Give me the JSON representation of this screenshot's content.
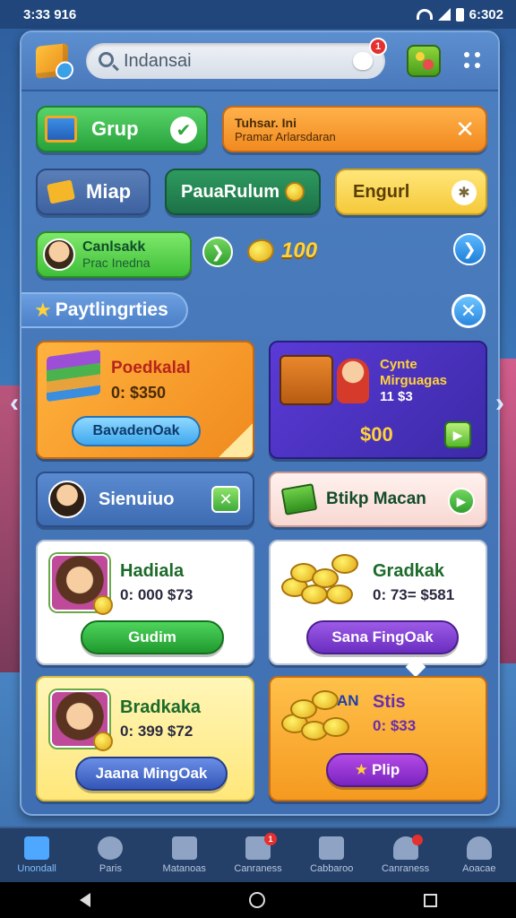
{
  "status_bar": {
    "time": "3:33 916",
    "battery_text": "6:302"
  },
  "header": {
    "search_value": "Indansai",
    "search_badge": "1"
  },
  "row1": {
    "grup_label": "Grup",
    "notice_line1": "Tuhsar. Ini",
    "notice_line2": "Pramar Arlarsdaran"
  },
  "row2": {
    "map_label": "Miap",
    "premium_label": "PauaRulum",
    "english_label": "Engurl"
  },
  "row3": {
    "user_name": "Canlsakk",
    "user_sub": "Prac Inedna",
    "coin_amount": "100"
  },
  "section": {
    "title": "Paytlingrties"
  },
  "promos": [
    {
      "title": "Poedkalal",
      "value": "0: $350",
      "button": "BavadenOak"
    },
    {
      "title": "Cynte Mirguagas",
      "value": "11 $3",
      "price": "$00"
    }
  ],
  "row_mid": {
    "rank_label": "Sienuiuo",
    "bank_label": "Btikp Macan"
  },
  "offers": [
    {
      "title": "Hadiala",
      "value": "0: 000 $73",
      "button": "Gudim"
    },
    {
      "title": "Gradkak",
      "value": "0: 73= $581",
      "button": "Sana FingOak"
    },
    {
      "title": "Bradkaka",
      "value": "0: 399 $72",
      "button": "Jaana MingOak"
    },
    {
      "title": "Stis",
      "prefix": "AN",
      "value": "0: $33",
      "button": "Plip"
    }
  ],
  "bottom_nav": [
    {
      "label": "Unondall",
      "icon": "home-icon",
      "active": true
    },
    {
      "label": "Paris",
      "icon": "search-icon"
    },
    {
      "label": "Matanoas",
      "icon": "bag-icon"
    },
    {
      "label": "Canraness",
      "icon": "checklist-icon",
      "badge": "1"
    },
    {
      "label": "Cabbaroo",
      "icon": "checkbox-icon"
    },
    {
      "label": "Canraness",
      "icon": "friends-icon",
      "dot": true
    },
    {
      "label": "Aoacae",
      "icon": "profile-icon"
    }
  ],
  "colors": {
    "panel": "#3f6fb2",
    "green_button": "#27a23c",
    "orange_notice": "#f18a20",
    "purple_card": "#3c2aa8",
    "nav_background": "#243f68"
  }
}
